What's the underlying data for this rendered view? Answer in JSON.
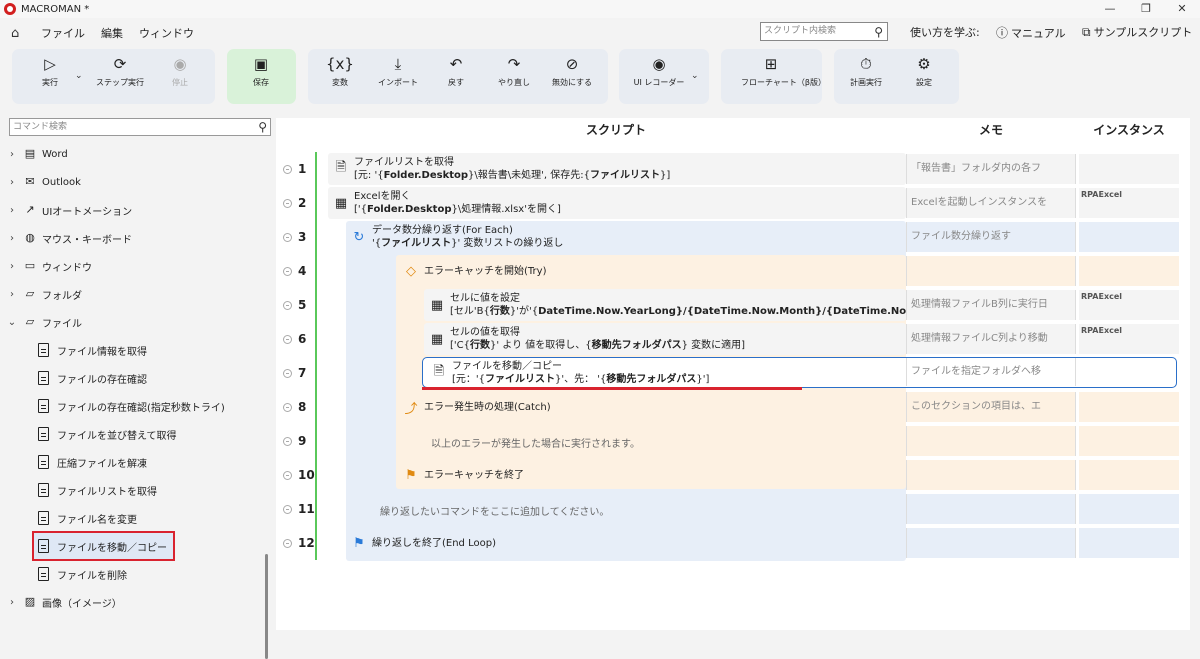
{
  "window": {
    "title": "MACROMAN *",
    "controls": [
      "—",
      "❐",
      "✕"
    ]
  },
  "menu": {
    "home": "⌂",
    "items": [
      "ファイル",
      "編集",
      "ウィンドウ"
    ]
  },
  "search": {
    "placeholder": "スクリプト内検索"
  },
  "learn": {
    "label": "使い方を学ぶ:",
    "manual": "マニュアル",
    "sample": "サンプルスクリプト"
  },
  "ribbon": {
    "run": "実行",
    "step": "ステップ実行",
    "stop": "停止",
    "save": "保存",
    "variables": "変数",
    "import": "インポート",
    "undo": "戻す",
    "redo": "やり直し",
    "disable": "無効にする",
    "ui_recorder": "UI レコーダー",
    "flowchart": "フローチャート（β版）",
    "schedule": "計画実行",
    "settings": "設定"
  },
  "sidebar": {
    "search_placeholder": "コマンド検索",
    "categories": [
      {
        "label": "Word",
        "icon": "word-icon"
      },
      {
        "label": "Outlook",
        "icon": "outlook-icon"
      },
      {
        "label": "UIオートメーション",
        "icon": "ui-automation-icon"
      },
      {
        "label": "マウス・キーボード",
        "icon": "mouse-icon"
      },
      {
        "label": "ウィンドウ",
        "icon": "window-icon"
      },
      {
        "label": "フォルダ",
        "icon": "folder-icon"
      },
      {
        "label": "ファイル",
        "icon": "folder-icon"
      }
    ],
    "file_items": [
      "ファイル情報を取得",
      "ファイルの存在確認",
      "ファイルの存在確認(指定秒数トライ)",
      "ファイルを並び替えて取得",
      "圧縮ファイルを解凍",
      "ファイルリストを取得",
      "ファイル名を変更",
      "ファイルを移動／コピー",
      "ファイルを削除"
    ],
    "last_category": "画像（イメージ）"
  },
  "columns": {
    "script": "スクリプト",
    "memo": "メモ",
    "instance": "インスタンス"
  },
  "rows": [
    {
      "n": "1",
      "line1": "ファイルリストを取得",
      "line2_pre": "[元: '{",
      "line2_b1": "Folder.Desktop",
      "line2_mid": "}\\報告書\\未処理', 保存先:{",
      "line2_b2": "ファイルリスト",
      "line2_post": "}]",
      "memo": "「報告書」フォルダ内の各フ",
      "inst": ""
    },
    {
      "n": "2",
      "line1": "Excelを開く",
      "line2_pre": "['{",
      "line2_b1": "Folder.Desktop",
      "line2_mid": "}\\処理情報.xlsx'を開く]",
      "line2_b2": "",
      "line2_post": "",
      "memo": "Excelを起動しインスタンスを",
      "inst": "RPAExcel"
    },
    {
      "n": "3",
      "line1": "データ数分繰り返す(For Each)",
      "line2_pre": "'{",
      "line2_b1": "ファイルリスト",
      "line2_mid": "}' 変数リストの繰り返し",
      "line2_b2": "",
      "line2_post": "",
      "memo": "ファイル数分繰り返す",
      "inst": ""
    },
    {
      "n": "4",
      "line1": "エラーキャッチを開始(Try)",
      "memo": "",
      "inst": ""
    },
    {
      "n": "5",
      "line1": "セルに値を設定",
      "line2_pre": "[セル'B{",
      "line2_b1": "行数",
      "line2_mid": "}'が'{",
      "line2_b2": "DateTime.Now.YearLong",
      "line2_post": "}/{DateTime.Now.Month}/{DateTime.Now",
      "memo": "処理情報ファイルB列に実行日",
      "inst": "RPAExcel"
    },
    {
      "n": "6",
      "line1": "セルの値を取得",
      "line2_pre": "['C{",
      "line2_b1": "行数",
      "line2_mid": "}' より 値を取得し、{",
      "line2_b2": "移動先フォルダパス",
      "line2_post": "} 変数に適用]",
      "memo": "処理情報ファイルC列より移動",
      "inst": "RPAExcel"
    },
    {
      "n": "7",
      "line1": "ファイルを移動／コピー",
      "line2_pre": "[元：'{",
      "line2_b1": "ファイルリスト",
      "line2_mid": "}'、先： '{",
      "line2_b2": "移動先フォルダパス",
      "line2_post": "}']",
      "memo": "ファイルを指定フォルダへ移",
      "inst": ""
    },
    {
      "n": "8",
      "line1": "エラー発生時の処理(Catch)",
      "memo": "このセクションの項目は、エ",
      "inst": ""
    },
    {
      "n": "9",
      "line1": "以上のエラーが発生した場合に実行されます。",
      "memo": "",
      "inst": ""
    },
    {
      "n": "10",
      "line1": "エラーキャッチを終了",
      "memo": "",
      "inst": ""
    },
    {
      "n": "11",
      "line1": "繰り返したいコマンドをここに追加してください。",
      "memo": "",
      "inst": ""
    },
    {
      "n": "12",
      "line1": "繰り返しを終了(End Loop)",
      "memo": "",
      "inst": ""
    }
  ],
  "colors": {
    "loop": "#e7eef8",
    "try": "#fdf1e2",
    "selected_outline": "#2a6fc9",
    "highlight": "#d9232f"
  }
}
